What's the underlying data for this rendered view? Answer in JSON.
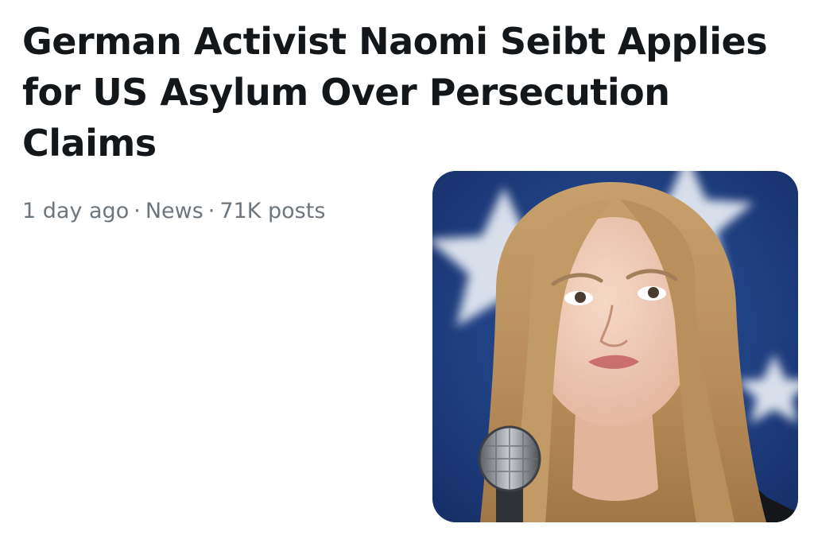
{
  "article": {
    "headline": "German Activist Naomi Seibt Applies for US Asylum Over Persecution Claims",
    "meta": {
      "time": "1 day ago",
      "category": "News",
      "posts": "71K posts",
      "separator": "·"
    }
  },
  "thumbnail": {
    "icon": "person-photo",
    "background_color": "#1f3f80",
    "accent_color": "#e9edf4"
  }
}
